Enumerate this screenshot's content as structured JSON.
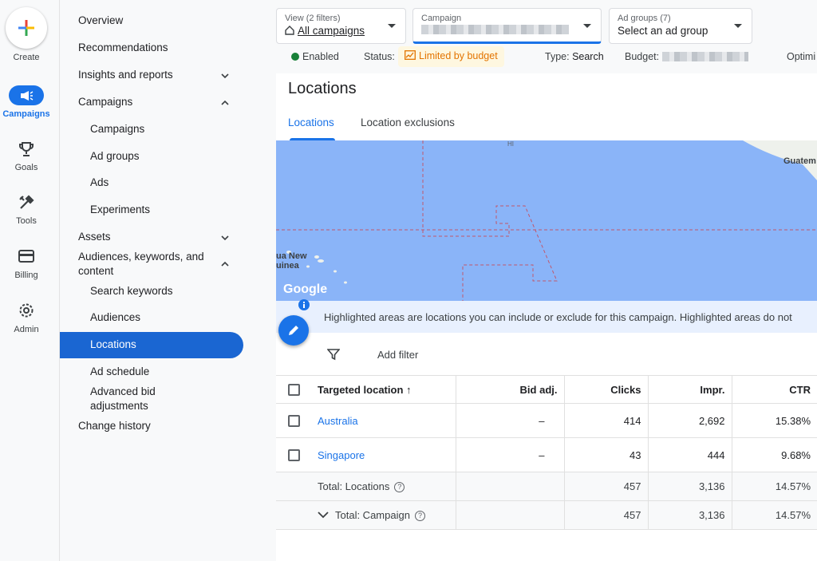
{
  "rail": {
    "create": "Create",
    "campaigns": "Campaigns",
    "goals": "Goals",
    "tools": "Tools",
    "billing": "Billing",
    "admin": "Admin"
  },
  "nav": {
    "overview": "Overview",
    "recommendations": "Recommendations",
    "insights": "Insights and reports",
    "campaigns_group": "Campaigns",
    "campaigns": "Campaigns",
    "ad_groups": "Ad groups",
    "ads": "Ads",
    "experiments": "Experiments",
    "assets": "Assets",
    "audiences_line1": "Audiences, keywords, and",
    "audiences_line2": "content",
    "search_keywords": "Search keywords",
    "audiences": "Audiences",
    "locations": "Locations",
    "ad_schedule": "Ad schedule",
    "advanced_bid_line1": "Advanced bid",
    "advanced_bid_line2": "adjustments",
    "change_history": "Change history"
  },
  "header": {
    "view_label": "View (2 filters)",
    "view_value": "All campaigns",
    "campaign_label": "Campaign",
    "adgroups_label": "Ad groups (7)",
    "adgroups_value": "Select an ad group",
    "enabled": "Enabled",
    "status_label": "Status:",
    "status_value": "Limited by budget",
    "type_label": "Type:",
    "type_value": "Search",
    "budget_label": "Budget:",
    "optim_label": "Optimi"
  },
  "page": {
    "title": "Locations",
    "tab_locations": "Locations",
    "tab_exclusions": "Location exclusions",
    "info": "Highlighted areas are locations you can include or exclude for this campaign. Highlighted areas do not",
    "add_filter": "Add filter"
  },
  "map": {
    "label_hi": "HI",
    "label_guatemala": "Guatem",
    "label_png_1": "ua New",
    "label_png_2": "uinea",
    "google": "Google"
  },
  "table": {
    "columns": [
      "Targeted location",
      "Bid adj.",
      "Clicks",
      "Impr.",
      "CTR"
    ],
    "rows": [
      {
        "location": "Australia",
        "bid": "–",
        "clicks": "414",
        "impr": "2,692",
        "ctr": "15.38%"
      },
      {
        "location": "Singapore",
        "bid": "–",
        "clicks": "43",
        "impr": "444",
        "ctr": "9.68%"
      }
    ],
    "total_locations": {
      "label": "Total: Locations",
      "clicks": "457",
      "impr": "3,136",
      "ctr": "14.57%"
    },
    "total_campaign": {
      "label": "Total: Campaign",
      "clicks": "457",
      "impr": "3,136",
      "ctr": "14.57%"
    }
  },
  "colors": {
    "accent": "#1a73e8",
    "status_warning": "#e37400",
    "enabled": "#188038",
    "map_water": "#8ab4f8"
  }
}
